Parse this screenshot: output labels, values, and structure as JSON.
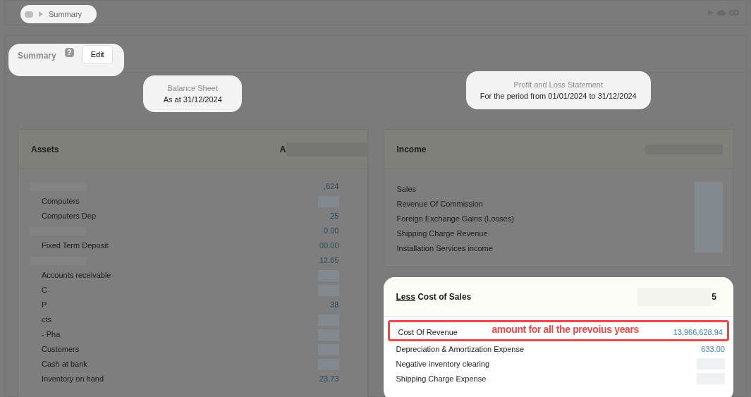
{
  "breadcrumb": {
    "spotlight": true,
    "current": "Summary"
  },
  "header": {
    "spotlight": true,
    "title": "Summary",
    "help": "?",
    "edit_button": "Edit"
  },
  "balance_sheet": {
    "spotlight": true,
    "title": "Balance Sheet",
    "subtitle": "As at 31/12/2024"
  },
  "profit_loss": {
    "spotlight": true,
    "title": "Profit and Loss Statement",
    "subtitle": "For the period from 01/01/2024 to 31/12/2024"
  },
  "assets": {
    "spotlight": false,
    "title": "Assets",
    "amount_fragment": "A",
    "rows": [
      {
        "label": "",
        "value": ",624"
      },
      {
        "label": "Computers",
        "value": "",
        "indent": true
      },
      {
        "label": "Computers Dep",
        "value": "25",
        "indent": true
      },
      {
        "label": "",
        "value": "0.00"
      },
      {
        "label": "Fixed Term Deposit",
        "value": "00.00",
        "indent": true
      },
      {
        "label": "",
        "value": "12.65"
      },
      {
        "label": "Accounts receivable",
        "value": "",
        "indent": true
      },
      {
        "label": "C",
        "value": "",
        "indent": true
      },
      {
        "label": "P",
        "value": "38",
        "indent": true
      },
      {
        "label": "cts",
        "value": "",
        "indent": true
      },
      {
        "label": "- Pha",
        "value": "",
        "indent": true
      },
      {
        "label": "Customers",
        "value": "",
        "indent": true
      },
      {
        "label": "Cash at bank",
        "value": "",
        "indent": true
      },
      {
        "label": "Inventory on hand",
        "value": "23.73",
        "indent": true
      }
    ]
  },
  "income": {
    "spotlight": false,
    "title": "Income",
    "rows": [
      {
        "label": "Sales",
        "value": ""
      },
      {
        "label": "Revenue Of Commission",
        "value": ""
      },
      {
        "label": "Foreign Exchange Gains (Losses)",
        "value": ""
      },
      {
        "label": "Shipping Charge Revenue",
        "value": ""
      },
      {
        "label": "Installation Services income",
        "value": ""
      }
    ]
  },
  "cost_of_sales": {
    "spotlight": true,
    "title_prefix": "Less",
    "title": "Cost of Sales",
    "amount_fragment": "5",
    "rows": [
      {
        "label": "Cost Of Revenue",
        "value": "13,966,628.94",
        "annotated": true
      },
      {
        "label": "Depreciation & Amortization Expense",
        "value": "633.00",
        "annotated": false
      },
      {
        "label": "Negative inventory clearing",
        "value": "",
        "annotated": false
      },
      {
        "label": "Shipping Charge Expense",
        "value": "",
        "annotated": false
      }
    ]
  },
  "annotation": "amount for all the prevoius years"
}
